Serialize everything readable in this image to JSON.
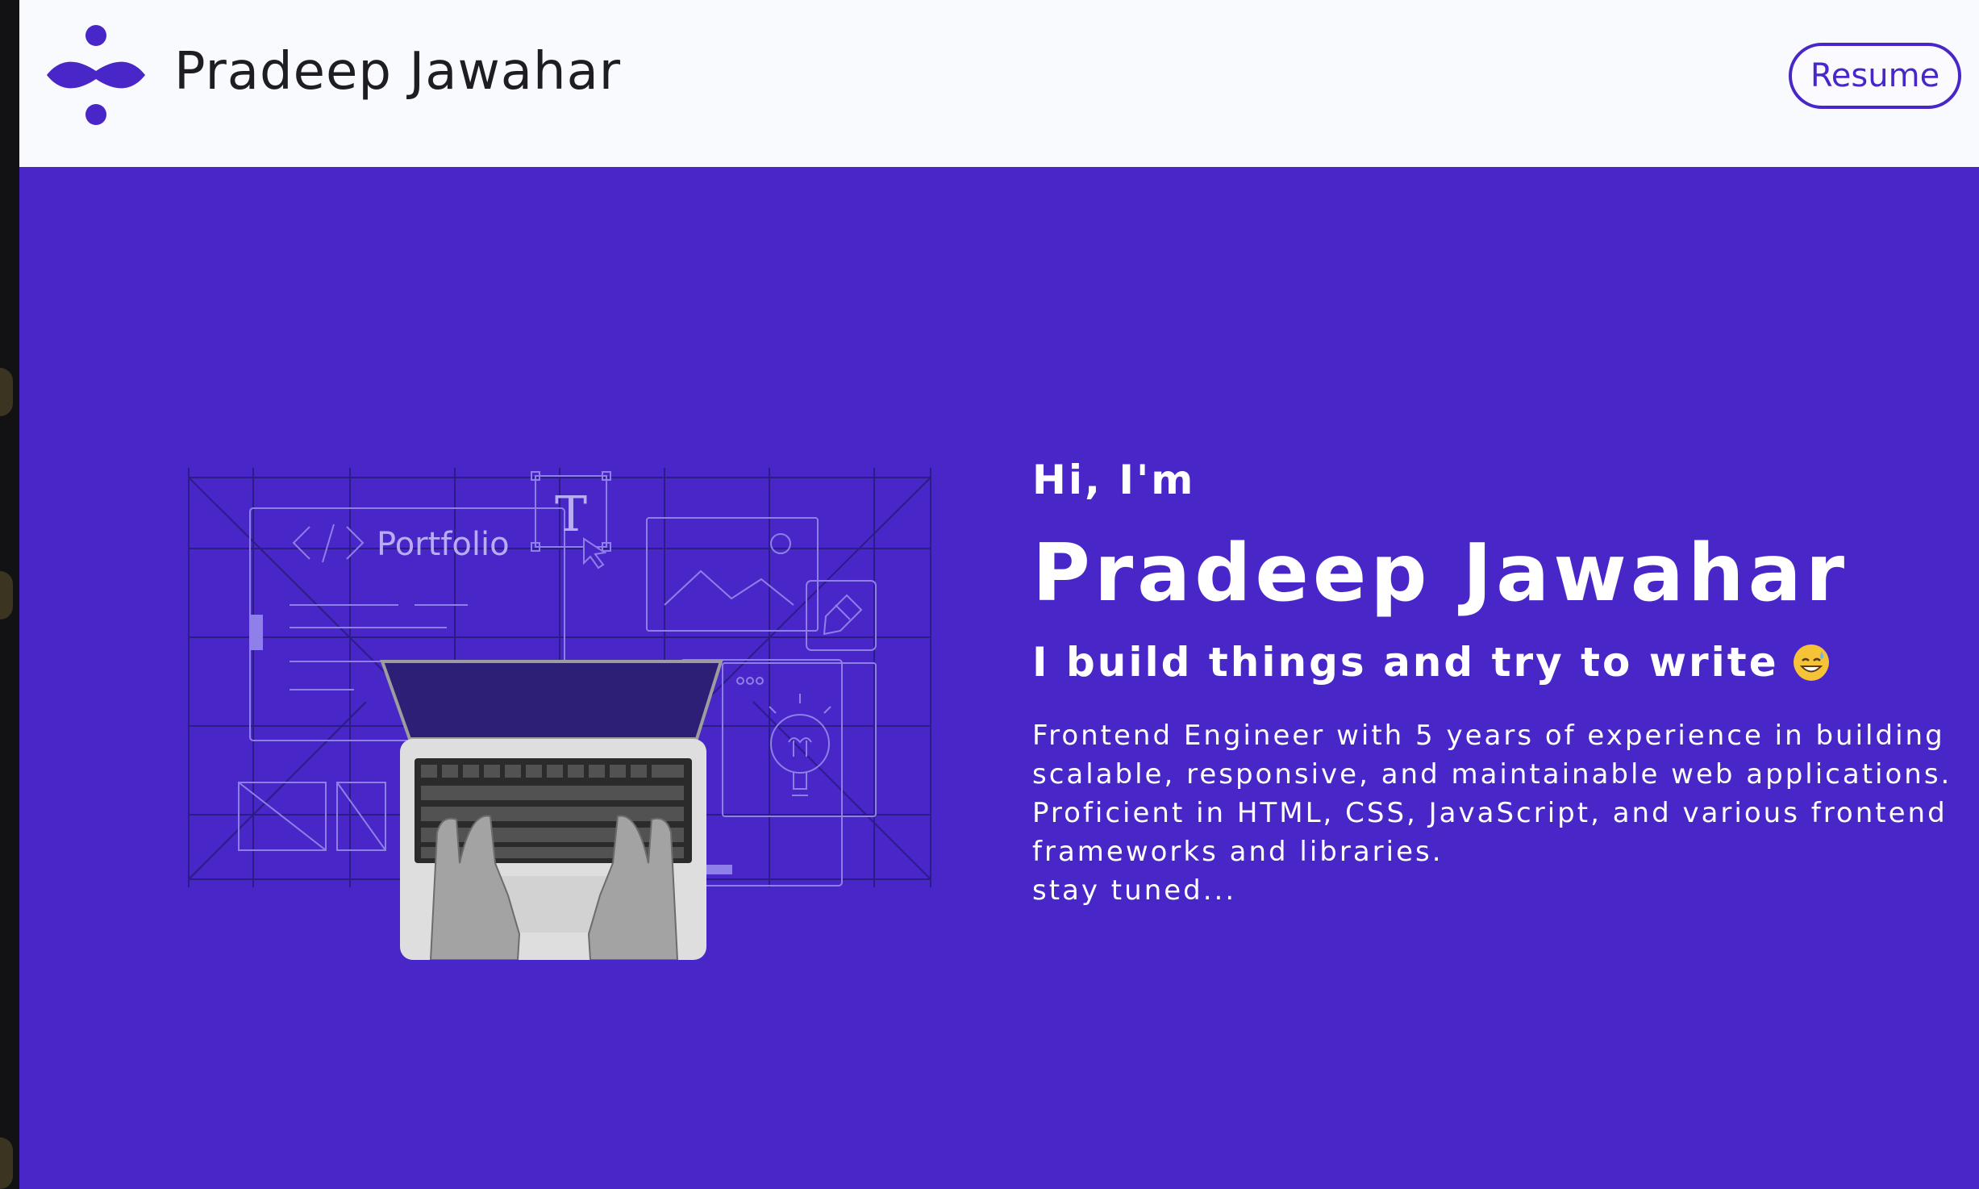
{
  "header": {
    "logo_icon": "abstract-dots-logo",
    "title": "Pradeep Jawahar",
    "resume_label": "Resume"
  },
  "hero": {
    "illustration": {
      "portfolio_label": "Portfolio",
      "text_tool_glyph": "T"
    },
    "greeting": "Hi, I'm",
    "name": "Pradeep Jawahar",
    "tagline": "I build things and try to write",
    "tagline_emoji": "grinning-sweat-emoji",
    "bio_lines": [
      "Frontend Engineer with 5 years of experience in building",
      "scalable, responsive, and maintainable web applications.",
      "Proficient in HTML, CSS, JavaScript, and various frontend",
      "frameworks and libraries.",
      "stay tuned..."
    ]
  },
  "colors": {
    "brand": "#4926c8",
    "header_bg": "#f9fafe",
    "text_light": "#ffffff"
  }
}
